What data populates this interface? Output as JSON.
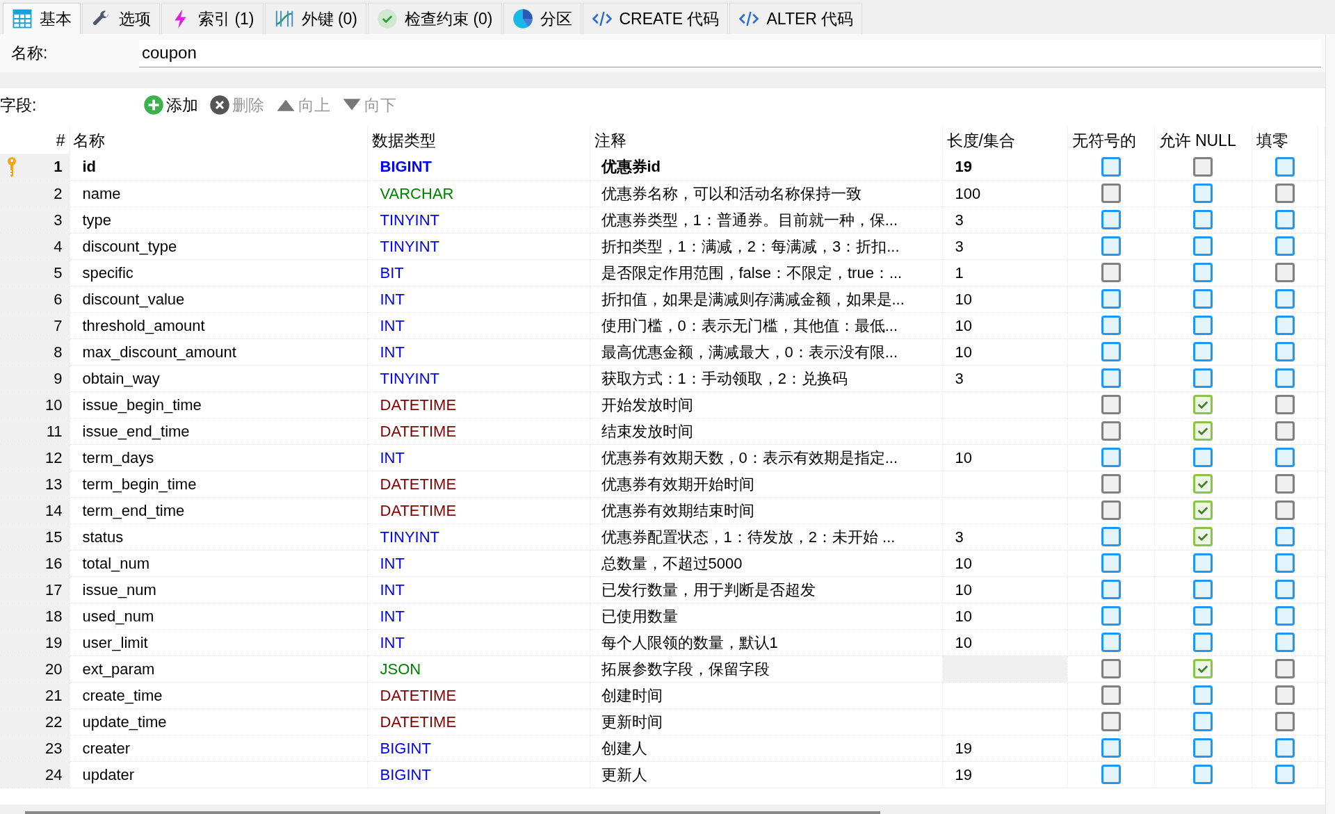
{
  "tabs": [
    {
      "label": "基本",
      "kind": "grid",
      "selected": true
    },
    {
      "label": "选项",
      "kind": "wrench",
      "selected": false
    },
    {
      "label": "索引 (1)",
      "kind": "bolt",
      "selected": false
    },
    {
      "label": "外键 (0)",
      "kind": "link",
      "selected": false
    },
    {
      "label": "检查约束 (0)",
      "kind": "check",
      "selected": false
    },
    {
      "label": "分区",
      "kind": "pie",
      "selected": false
    },
    {
      "label": "CREATE 代码",
      "kind": "code",
      "selected": false
    },
    {
      "label": "ALTER 代码",
      "kind": "code",
      "selected": false
    }
  ],
  "name_field": {
    "label": "名称:",
    "value": "coupon"
  },
  "fields_toolbar": {
    "label": "字段:",
    "buttons": [
      {
        "label": "添加",
        "kind": "add",
        "disabled": false
      },
      {
        "label": "删除",
        "kind": "remove",
        "disabled": true
      },
      {
        "label": "向上",
        "kind": "up",
        "disabled": true
      },
      {
        "label": "向下",
        "kind": "down",
        "disabled": true
      }
    ]
  },
  "table": {
    "columns": [
      "#",
      "名称",
      "数据类型",
      "注释",
      "长度/集合",
      "无符号的",
      "允许 NULL",
      "填零"
    ],
    "rows": [
      {
        "num": "1",
        "name": "id",
        "type": "BIGINT",
        "color": "#0000ff",
        "comment": "优惠券id",
        "length": "19",
        "primary_key": true,
        "length_disabled": false,
        "unsigned": {
          "checked": false,
          "disabled": false
        },
        "allow_null": {
          "checked": false,
          "disabled": true
        },
        "zerofill": {
          "checked": false,
          "disabled": false
        }
      },
      {
        "num": "2",
        "name": "name",
        "type": "VARCHAR",
        "color": "#008000",
        "comment": "优惠券名称，可以和活动名称保持一致",
        "length": "100",
        "primary_key": false,
        "length_disabled": false,
        "unsigned": {
          "checked": false,
          "disabled": true
        },
        "allow_null": {
          "checked": false,
          "disabled": false
        },
        "zerofill": {
          "checked": false,
          "disabled": true
        }
      },
      {
        "num": "3",
        "name": "type",
        "type": "TINYINT",
        "color": "#0000ff",
        "comment": "优惠券类型，1：普通券。目前就一种，保...",
        "length": "3",
        "primary_key": false,
        "length_disabled": false,
        "unsigned": {
          "checked": false,
          "disabled": false
        },
        "allow_null": {
          "checked": false,
          "disabled": false
        },
        "zerofill": {
          "checked": false,
          "disabled": false
        }
      },
      {
        "num": "4",
        "name": "discount_type",
        "type": "TINYINT",
        "color": "#0000ff",
        "comment": "折扣类型，1：满减，2：每满减，3：折扣...",
        "length": "3",
        "primary_key": false,
        "length_disabled": false,
        "unsigned": {
          "checked": false,
          "disabled": false
        },
        "allow_null": {
          "checked": false,
          "disabled": false
        },
        "zerofill": {
          "checked": false,
          "disabled": false
        }
      },
      {
        "num": "5",
        "name": "specific",
        "type": "BIT",
        "color": "#0000ff",
        "comment": "是否限定作用范围，false：不限定，true：...",
        "length": "1",
        "primary_key": false,
        "length_disabled": false,
        "unsigned": {
          "checked": false,
          "disabled": true
        },
        "allow_null": {
          "checked": false,
          "disabled": false
        },
        "zerofill": {
          "checked": false,
          "disabled": true
        }
      },
      {
        "num": "6",
        "name": "discount_value",
        "type": "INT",
        "color": "#0000ff",
        "comment": "折扣值，如果是满减则存满减金额，如果是...",
        "length": "10",
        "primary_key": false,
        "length_disabled": false,
        "unsigned": {
          "checked": false,
          "disabled": false
        },
        "allow_null": {
          "checked": false,
          "disabled": false
        },
        "zerofill": {
          "checked": false,
          "disabled": false
        }
      },
      {
        "num": "7",
        "name": "threshold_amount",
        "type": "INT",
        "color": "#0000ff",
        "comment": "使用门槛，0：表示无门槛，其他值：最低...",
        "length": "10",
        "primary_key": false,
        "length_disabled": false,
        "unsigned": {
          "checked": false,
          "disabled": false
        },
        "allow_null": {
          "checked": false,
          "disabled": false
        },
        "zerofill": {
          "checked": false,
          "disabled": false
        }
      },
      {
        "num": "8",
        "name": "max_discount_amount",
        "type": "INT",
        "color": "#0000ff",
        "comment": "最高优惠金额，满减最大，0：表示没有限...",
        "length": "10",
        "primary_key": false,
        "length_disabled": false,
        "unsigned": {
          "checked": false,
          "disabled": false
        },
        "allow_null": {
          "checked": false,
          "disabled": false
        },
        "zerofill": {
          "checked": false,
          "disabled": false
        }
      },
      {
        "num": "9",
        "name": "obtain_way",
        "type": "TINYINT",
        "color": "#0000ff",
        "comment": "获取方式：1：手动领取，2：兑换码",
        "length": "3",
        "primary_key": false,
        "length_disabled": false,
        "unsigned": {
          "checked": false,
          "disabled": false
        },
        "allow_null": {
          "checked": false,
          "disabled": false
        },
        "zerofill": {
          "checked": false,
          "disabled": false
        }
      },
      {
        "num": "10",
        "name": "issue_begin_time",
        "type": "DATETIME",
        "color": "#800000",
        "comment": "开始发放时间",
        "primary_key": false,
        "length_disabled": false,
        "unsigned": {
          "checked": false,
          "disabled": true
        },
        "allow_null": {
          "checked": true,
          "disabled": false
        },
        "zerofill": {
          "checked": false,
          "disabled": true
        }
      },
      {
        "num": "11",
        "name": "issue_end_time",
        "type": "DATETIME",
        "color": "#800000",
        "comment": "结束发放时间",
        "primary_key": false,
        "length_disabled": false,
        "unsigned": {
          "checked": false,
          "disabled": true
        },
        "allow_null": {
          "checked": true,
          "disabled": false
        },
        "zerofill": {
          "checked": false,
          "disabled": true
        }
      },
      {
        "num": "12",
        "name": "term_days",
        "type": "INT",
        "color": "#0000ff",
        "comment": "优惠券有效期天数，0：表示有效期是指定...",
        "length": "10",
        "primary_key": false,
        "length_disabled": false,
        "unsigned": {
          "checked": false,
          "disabled": false
        },
        "allow_null": {
          "checked": false,
          "disabled": false
        },
        "zerofill": {
          "checked": false,
          "disabled": false
        }
      },
      {
        "num": "13",
        "name": "term_begin_time",
        "type": "DATETIME",
        "color": "#800000",
        "comment": "优惠券有效期开始时间",
        "primary_key": false,
        "length_disabled": false,
        "unsigned": {
          "checked": false,
          "disabled": true
        },
        "allow_null": {
          "checked": true,
          "disabled": false
        },
        "zerofill": {
          "checked": false,
          "disabled": true
        }
      },
      {
        "num": "14",
        "name": "term_end_time",
        "type": "DATETIME",
        "color": "#800000",
        "comment": "优惠券有效期结束时间",
        "primary_key": false,
        "length_disabled": false,
        "unsigned": {
          "checked": false,
          "disabled": true
        },
        "allow_null": {
          "checked": true,
          "disabled": false
        },
        "zerofill": {
          "checked": false,
          "disabled": true
        }
      },
      {
        "num": "15",
        "name": "status",
        "type": "TINYINT",
        "color": "#0000ff",
        "comment": "优惠券配置状态，1：待发放，2：未开始 ...",
        "length": "3",
        "primary_key": false,
        "length_disabled": false,
        "unsigned": {
          "checked": false,
          "disabled": false
        },
        "allow_null": {
          "checked": true,
          "disabled": false
        },
        "zerofill": {
          "checked": false,
          "disabled": false
        }
      },
      {
        "num": "16",
        "name": "total_num",
        "type": "INT",
        "color": "#0000ff",
        "comment": "总数量，不超过5000",
        "length": "10",
        "primary_key": false,
        "length_disabled": false,
        "unsigned": {
          "checked": false,
          "disabled": false
        },
        "allow_null": {
          "checked": false,
          "disabled": false
        },
        "zerofill": {
          "checked": false,
          "disabled": false
        }
      },
      {
        "num": "17",
        "name": "issue_num",
        "type": "INT",
        "color": "#0000ff",
        "comment": "已发行数量，用于判断是否超发",
        "length": "10",
        "primary_key": false,
        "length_disabled": false,
        "unsigned": {
          "checked": false,
          "disabled": false
        },
        "allow_null": {
          "checked": false,
          "disabled": false
        },
        "zerofill": {
          "checked": false,
          "disabled": false
        }
      },
      {
        "num": "18",
        "name": "used_num",
        "type": "INT",
        "color": "#0000ff",
        "comment": "已使用数量",
        "length": "10",
        "primary_key": false,
        "length_disabled": false,
        "unsigned": {
          "checked": false,
          "disabled": false
        },
        "allow_null": {
          "checked": false,
          "disabled": false
        },
        "zerofill": {
          "checked": false,
          "disabled": false
        }
      },
      {
        "num": "19",
        "name": "user_limit",
        "type": "INT",
        "color": "#0000ff",
        "comment": "每个人限领的数量，默认1",
        "length": "10",
        "primary_key": false,
        "length_disabled": false,
        "unsigned": {
          "checked": false,
          "disabled": false
        },
        "allow_null": {
          "checked": false,
          "disabled": false
        },
        "zerofill": {
          "checked": false,
          "disabled": false
        }
      },
      {
        "num": "20",
        "name": "ext_param",
        "type": "JSON",
        "color": "#008000",
        "comment": "拓展参数字段，保留字段",
        "primary_key": false,
        "length_disabled": true,
        "unsigned": {
          "checked": false,
          "disabled": true
        },
        "allow_null": {
          "checked": true,
          "disabled": false
        },
        "zerofill": {
          "checked": false,
          "disabled": true
        }
      },
      {
        "num": "21",
        "name": "create_time",
        "type": "DATETIME",
        "color": "#800000",
        "comment": "创建时间",
        "primary_key": false,
        "length_disabled": false,
        "unsigned": {
          "checked": false,
          "disabled": true
        },
        "allow_null": {
          "checked": false,
          "disabled": false
        },
        "zerofill": {
          "checked": false,
          "disabled": true
        }
      },
      {
        "num": "22",
        "name": "update_time",
        "type": "DATETIME",
        "color": "#800000",
        "comment": "更新时间",
        "primary_key": false,
        "length_disabled": false,
        "unsigned": {
          "checked": false,
          "disabled": true
        },
        "allow_null": {
          "checked": false,
          "disabled": false
        },
        "zerofill": {
          "checked": false,
          "disabled": true
        }
      },
      {
        "num": "23",
        "name": "creater",
        "type": "BIGINT",
        "color": "#0000ff",
        "comment": "创建人",
        "length": "19",
        "primary_key": false,
        "length_disabled": false,
        "unsigned": {
          "checked": false,
          "disabled": false
        },
        "allow_null": {
          "checked": false,
          "disabled": false
        },
        "zerofill": {
          "checked": false,
          "disabled": false
        }
      },
      {
        "num": "24",
        "name": "updater",
        "type": "BIGINT",
        "color": "#0000ff",
        "comment": "更新人",
        "length": "19",
        "primary_key": false,
        "length_disabled": false,
        "unsigned": {
          "checked": false,
          "disabled": false
        },
        "allow_null": {
          "checked": false,
          "disabled": false
        },
        "zerofill": {
          "checked": false,
          "disabled": false
        }
      }
    ]
  }
}
